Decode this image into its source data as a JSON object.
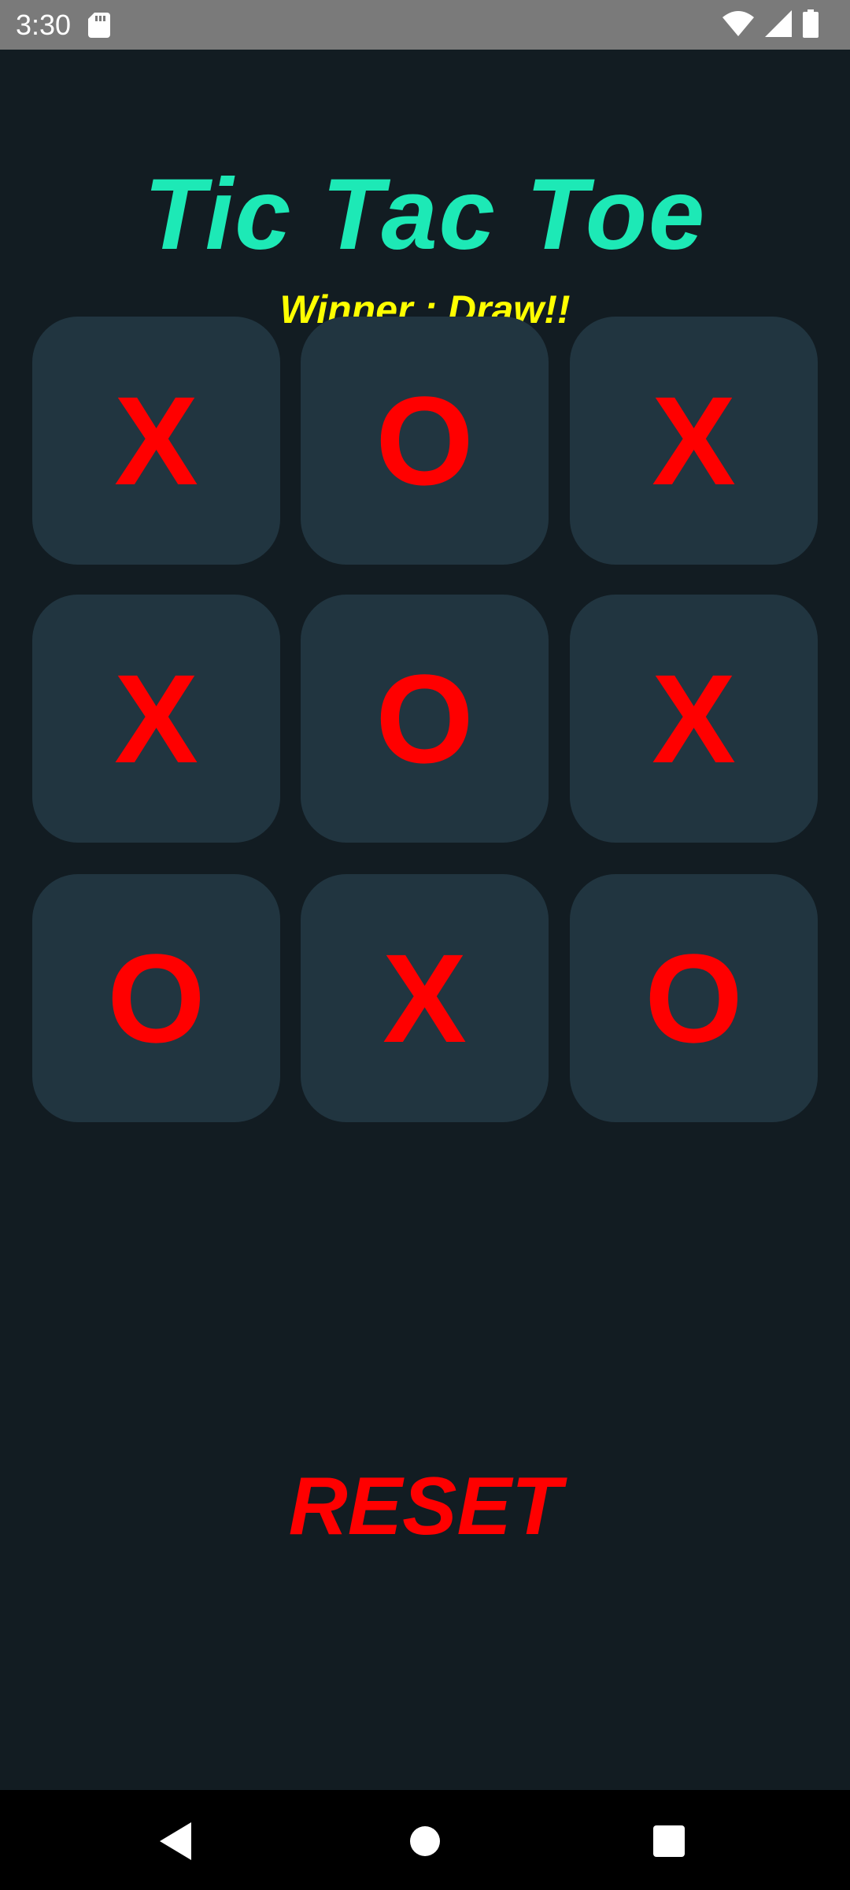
{
  "status_bar": {
    "time": "3:30",
    "icons": [
      "sd-card-icon",
      "wifi-icon",
      "signal-icon",
      "battery-icon"
    ]
  },
  "app": {
    "title": "Tic Tac Toe",
    "winner_text": "Winner : Draw!!",
    "board": [
      [
        "X",
        "O",
        "X"
      ],
      [
        "X",
        "O",
        "X"
      ],
      [
        "O",
        "X",
        "O"
      ]
    ],
    "reset_label": "RESET",
    "colors": {
      "background": "#121c22",
      "cell": "#213540",
      "title": "#1de9b6",
      "winner": "#ffff00",
      "mark": "#ff0000"
    }
  },
  "nav_bar": {
    "buttons": [
      "back-icon",
      "home-icon",
      "recents-icon"
    ]
  }
}
